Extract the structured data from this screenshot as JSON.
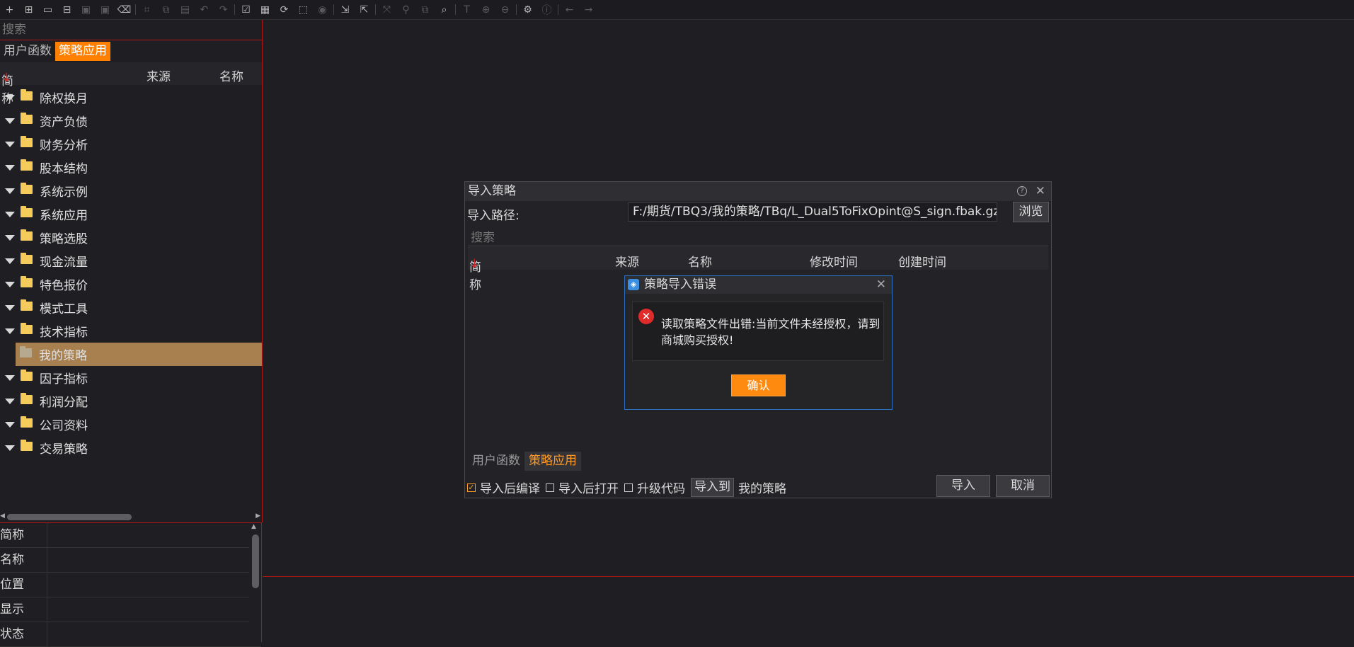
{
  "toolbar": {
    "groups": [
      [
        "new-function-icon",
        "new-strategy-icon",
        "open-folder-icon",
        "open-file-icon",
        "save-icon",
        "save-all-icon",
        "delete-icon"
      ],
      [
        "crop-icon",
        "copy-icon",
        "paste-icon",
        "undo-icon",
        "redo-icon"
      ],
      [
        "check-icon",
        "compile-icon",
        "refresh-icon",
        "select-icon",
        "stop-icon"
      ],
      [
        "import-icon",
        "export-icon"
      ],
      [
        "fit-icon",
        "search-icon",
        "find-icon",
        "find-replace-icon"
      ],
      [
        "text-icon",
        "zoom-in-icon",
        "zoom-out-icon"
      ],
      [
        "settings-icon",
        "info-icon"
      ],
      [
        "back-icon",
        "forward-icon"
      ]
    ]
  },
  "left": {
    "search_placeholder": "搜索",
    "tabs": [
      "用户函数",
      "策略应用"
    ],
    "columns": {
      "short": "简称",
      "source": "来源",
      "name": "名称"
    },
    "tree": [
      {
        "label": "除权换月"
      },
      {
        "label": "资产负债"
      },
      {
        "label": "财务分析"
      },
      {
        "label": "股本结构"
      },
      {
        "label": "系统示例"
      },
      {
        "label": "系统应用"
      },
      {
        "label": "策略选股"
      },
      {
        "label": "现金流量"
      },
      {
        "label": "特色报价"
      },
      {
        "label": "模式工具"
      },
      {
        "label": "技术指标"
      },
      {
        "label": "我的策略",
        "selected": true
      },
      {
        "label": "因子指标"
      },
      {
        "label": "利润分配"
      },
      {
        "label": "公司资料"
      },
      {
        "label": "交易策略"
      }
    ],
    "props": [
      "简称",
      "名称",
      "位置",
      "显示",
      "状态"
    ]
  },
  "import_dialog": {
    "title": "导入策略",
    "path_label": "导入路径:",
    "path_value": "F:/期货/TBQ3/我的策略/TBq/L_Dual5ToFixOpint@S_sign.fbak.gz",
    "browse": "浏览",
    "search_placeholder": "搜索",
    "columns": {
      "short": "简称",
      "source": "来源",
      "name": "名称",
      "modified": "修改时间",
      "created": "创建时间"
    },
    "tabs": [
      "用户函数",
      "策略应用"
    ],
    "options": {
      "compile_after": "导入后编译",
      "open_after": "导入后打开",
      "upgrade_code": "升级代码",
      "import_to": "导入到",
      "target": "我的策略"
    },
    "import_btn": "导入",
    "cancel_btn": "取消"
  },
  "error_dialog": {
    "title": "策略导入错误",
    "message": "读取策略文件出错:当前文件未经授权，请到商城购买授权!",
    "confirm": "确认"
  },
  "colors": {
    "accent": "#ff7f00",
    "selected_row": "#a8804f",
    "border_red": "#b01818",
    "error_red": "#e02b2b"
  }
}
